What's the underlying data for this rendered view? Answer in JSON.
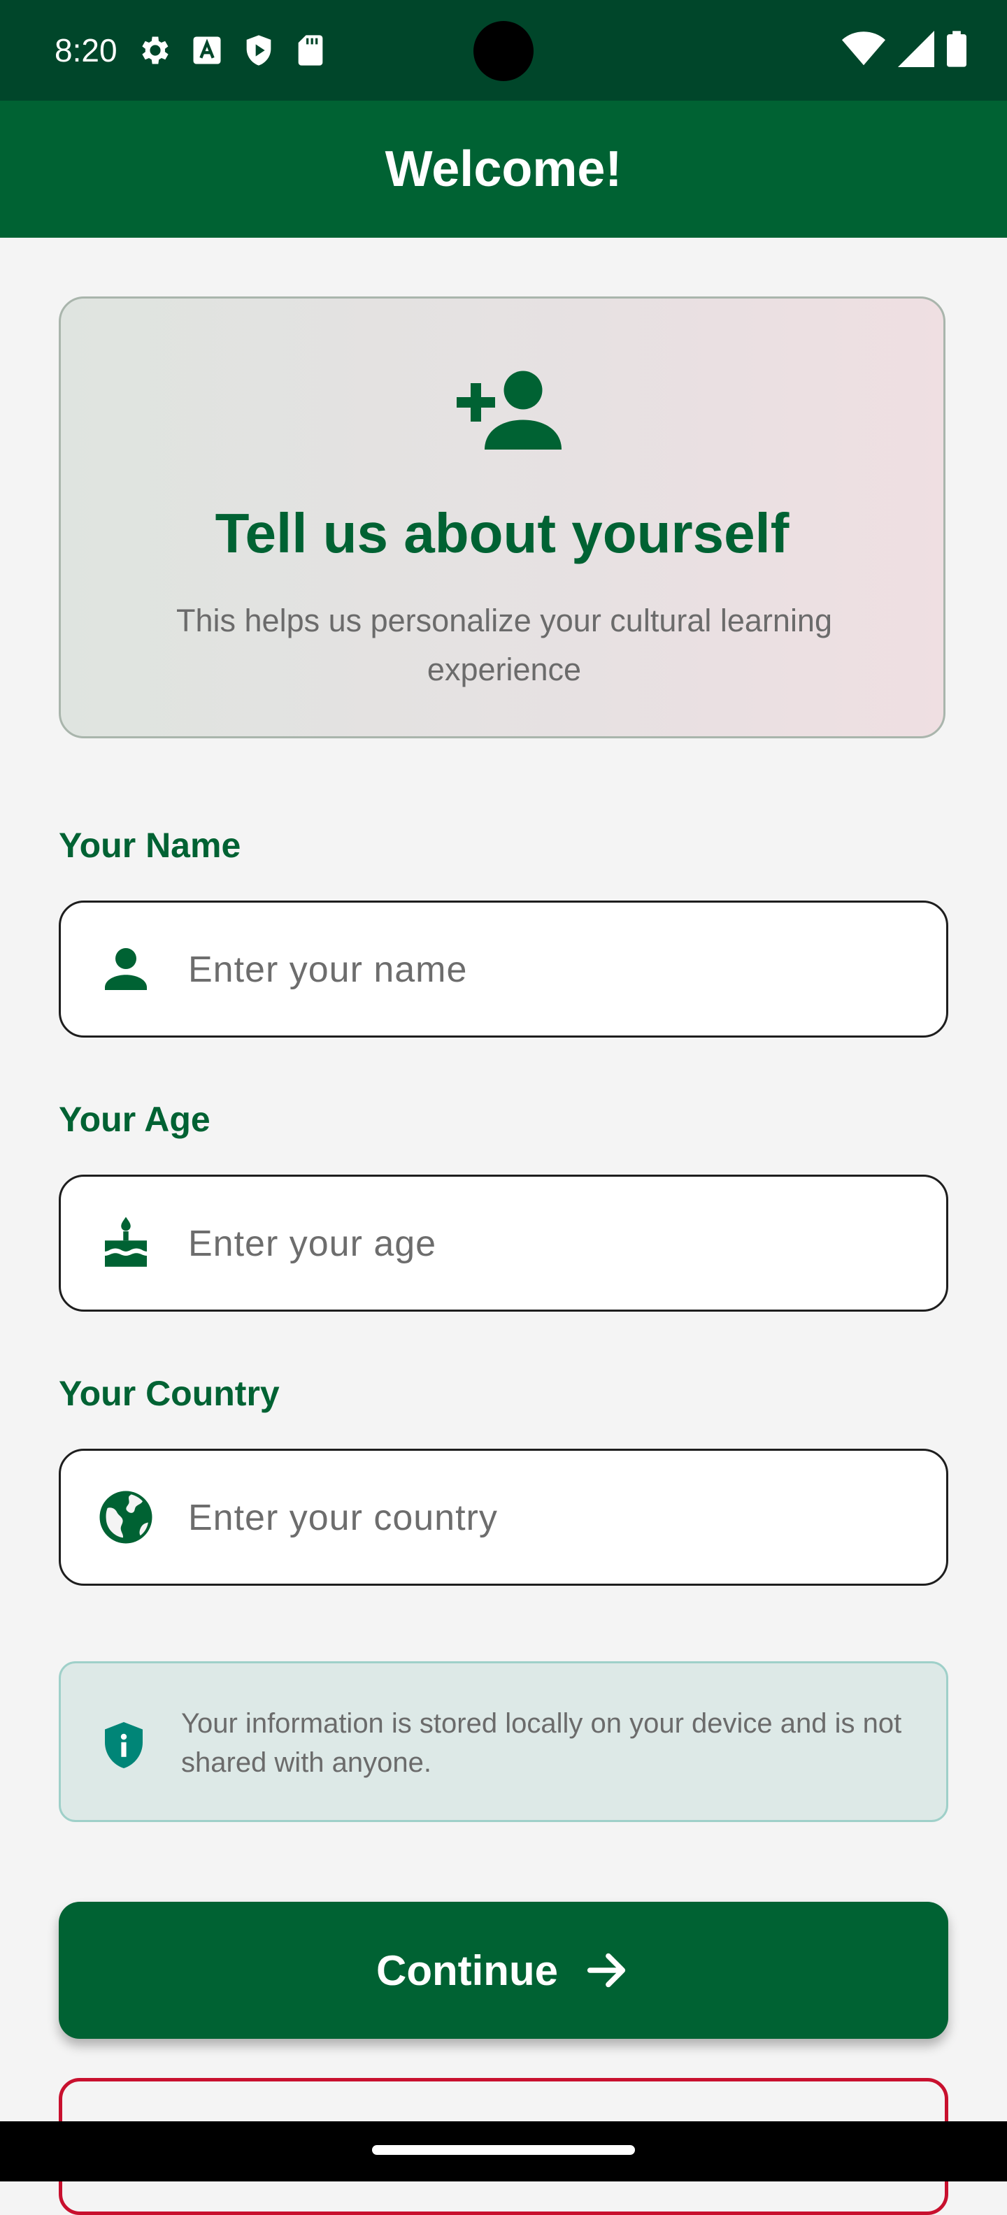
{
  "status_bar": {
    "time": "8:20",
    "left_icons": [
      "settings-icon",
      "font-a-icon",
      "shield-play-icon",
      "sd-card-icon"
    ],
    "right_icons": [
      "wifi-icon",
      "cellular-signal-icon",
      "battery-icon"
    ]
  },
  "app_bar": {
    "title": "Welcome!"
  },
  "hero": {
    "icon": "person-add-icon",
    "title": "Tell us about yourself",
    "subtitle": "This helps us personalize your cultural learning experience"
  },
  "form": {
    "name": {
      "label": "Your Name",
      "placeholder": "Enter your name",
      "value": "",
      "icon": "person-icon"
    },
    "age": {
      "label": "Your Age",
      "placeholder": "Enter your age",
      "value": "",
      "icon": "cake-icon"
    },
    "country": {
      "label": "Your Country",
      "placeholder": "Enter your country",
      "value": "",
      "icon": "globe-icon"
    }
  },
  "privacy": {
    "icon": "shield-info-icon",
    "text": "Your information is stored locally on your device and is not shared with anyone."
  },
  "continue_button": {
    "label": "Continue",
    "icon": "arrow-right-icon"
  },
  "colors": {
    "primary_green": "#006233",
    "status_bar": "#00462a",
    "accent_red": "#c8102e",
    "teal": "#008577"
  }
}
